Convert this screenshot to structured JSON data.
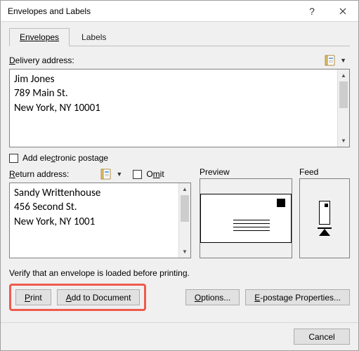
{
  "window": {
    "title": "Envelopes and Labels",
    "help": "?",
    "close": "✕"
  },
  "tabs": {
    "envelopes": "Envelopes",
    "labels": "Labels"
  },
  "delivery": {
    "label": "Delivery address:",
    "value": "Jim Jones\n789 Main St.\nNew York, NY 10001"
  },
  "electronic_postage": {
    "label": "Add electronic postage"
  },
  "return": {
    "label": "Return address:",
    "omit": "Omit",
    "value": "Sandy Writtenhouse\n456 Second St.\nNew York, NY 1001"
  },
  "preview": {
    "label": "Preview"
  },
  "feed": {
    "label": "Feed"
  },
  "verify": "Verify that an envelope is loaded before printing.",
  "buttons": {
    "print": "Print",
    "add_to_doc": "Add to Document",
    "options": "Options...",
    "epostage": "E-postage Properties...",
    "cancel": "Cancel"
  },
  "icons": {
    "addressbook": "address-book-icon",
    "caret": "▼"
  }
}
